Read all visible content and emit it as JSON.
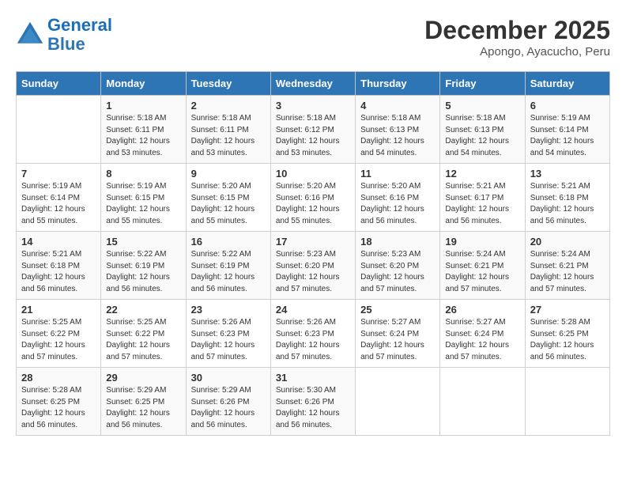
{
  "header": {
    "logo_general": "General",
    "logo_blue": "Blue",
    "month": "December 2025",
    "location": "Apongo, Ayacucho, Peru"
  },
  "days_of_week": [
    "Sunday",
    "Monday",
    "Tuesday",
    "Wednesday",
    "Thursday",
    "Friday",
    "Saturday"
  ],
  "weeks": [
    [
      {
        "day": "",
        "info": ""
      },
      {
        "day": "1",
        "info": "Sunrise: 5:18 AM\nSunset: 6:11 PM\nDaylight: 12 hours\nand 53 minutes."
      },
      {
        "day": "2",
        "info": "Sunrise: 5:18 AM\nSunset: 6:11 PM\nDaylight: 12 hours\nand 53 minutes."
      },
      {
        "day": "3",
        "info": "Sunrise: 5:18 AM\nSunset: 6:12 PM\nDaylight: 12 hours\nand 53 minutes."
      },
      {
        "day": "4",
        "info": "Sunrise: 5:18 AM\nSunset: 6:13 PM\nDaylight: 12 hours\nand 54 minutes."
      },
      {
        "day": "5",
        "info": "Sunrise: 5:18 AM\nSunset: 6:13 PM\nDaylight: 12 hours\nand 54 minutes."
      },
      {
        "day": "6",
        "info": "Sunrise: 5:19 AM\nSunset: 6:14 PM\nDaylight: 12 hours\nand 54 minutes."
      }
    ],
    [
      {
        "day": "7",
        "info": "Sunrise: 5:19 AM\nSunset: 6:14 PM\nDaylight: 12 hours\nand 55 minutes."
      },
      {
        "day": "8",
        "info": "Sunrise: 5:19 AM\nSunset: 6:15 PM\nDaylight: 12 hours\nand 55 minutes."
      },
      {
        "day": "9",
        "info": "Sunrise: 5:20 AM\nSunset: 6:15 PM\nDaylight: 12 hours\nand 55 minutes."
      },
      {
        "day": "10",
        "info": "Sunrise: 5:20 AM\nSunset: 6:16 PM\nDaylight: 12 hours\nand 55 minutes."
      },
      {
        "day": "11",
        "info": "Sunrise: 5:20 AM\nSunset: 6:16 PM\nDaylight: 12 hours\nand 56 minutes."
      },
      {
        "day": "12",
        "info": "Sunrise: 5:21 AM\nSunset: 6:17 PM\nDaylight: 12 hours\nand 56 minutes."
      },
      {
        "day": "13",
        "info": "Sunrise: 5:21 AM\nSunset: 6:18 PM\nDaylight: 12 hours\nand 56 minutes."
      }
    ],
    [
      {
        "day": "14",
        "info": "Sunrise: 5:21 AM\nSunset: 6:18 PM\nDaylight: 12 hours\nand 56 minutes."
      },
      {
        "day": "15",
        "info": "Sunrise: 5:22 AM\nSunset: 6:19 PM\nDaylight: 12 hours\nand 56 minutes."
      },
      {
        "day": "16",
        "info": "Sunrise: 5:22 AM\nSunset: 6:19 PM\nDaylight: 12 hours\nand 56 minutes."
      },
      {
        "day": "17",
        "info": "Sunrise: 5:23 AM\nSunset: 6:20 PM\nDaylight: 12 hours\nand 57 minutes."
      },
      {
        "day": "18",
        "info": "Sunrise: 5:23 AM\nSunset: 6:20 PM\nDaylight: 12 hours\nand 57 minutes."
      },
      {
        "day": "19",
        "info": "Sunrise: 5:24 AM\nSunset: 6:21 PM\nDaylight: 12 hours\nand 57 minutes."
      },
      {
        "day": "20",
        "info": "Sunrise: 5:24 AM\nSunset: 6:21 PM\nDaylight: 12 hours\nand 57 minutes."
      }
    ],
    [
      {
        "day": "21",
        "info": "Sunrise: 5:25 AM\nSunset: 6:22 PM\nDaylight: 12 hours\nand 57 minutes."
      },
      {
        "day": "22",
        "info": "Sunrise: 5:25 AM\nSunset: 6:22 PM\nDaylight: 12 hours\nand 57 minutes."
      },
      {
        "day": "23",
        "info": "Sunrise: 5:26 AM\nSunset: 6:23 PM\nDaylight: 12 hours\nand 57 minutes."
      },
      {
        "day": "24",
        "info": "Sunrise: 5:26 AM\nSunset: 6:23 PM\nDaylight: 12 hours\nand 57 minutes."
      },
      {
        "day": "25",
        "info": "Sunrise: 5:27 AM\nSunset: 6:24 PM\nDaylight: 12 hours\nand 57 minutes."
      },
      {
        "day": "26",
        "info": "Sunrise: 5:27 AM\nSunset: 6:24 PM\nDaylight: 12 hours\nand 57 minutes."
      },
      {
        "day": "27",
        "info": "Sunrise: 5:28 AM\nSunset: 6:25 PM\nDaylight: 12 hours\nand 56 minutes."
      }
    ],
    [
      {
        "day": "28",
        "info": "Sunrise: 5:28 AM\nSunset: 6:25 PM\nDaylight: 12 hours\nand 56 minutes."
      },
      {
        "day": "29",
        "info": "Sunrise: 5:29 AM\nSunset: 6:25 PM\nDaylight: 12 hours\nand 56 minutes."
      },
      {
        "day": "30",
        "info": "Sunrise: 5:29 AM\nSunset: 6:26 PM\nDaylight: 12 hours\nand 56 minutes."
      },
      {
        "day": "31",
        "info": "Sunrise: 5:30 AM\nSunset: 6:26 PM\nDaylight: 12 hours\nand 56 minutes."
      },
      {
        "day": "",
        "info": ""
      },
      {
        "day": "",
        "info": ""
      },
      {
        "day": "",
        "info": ""
      }
    ]
  ]
}
